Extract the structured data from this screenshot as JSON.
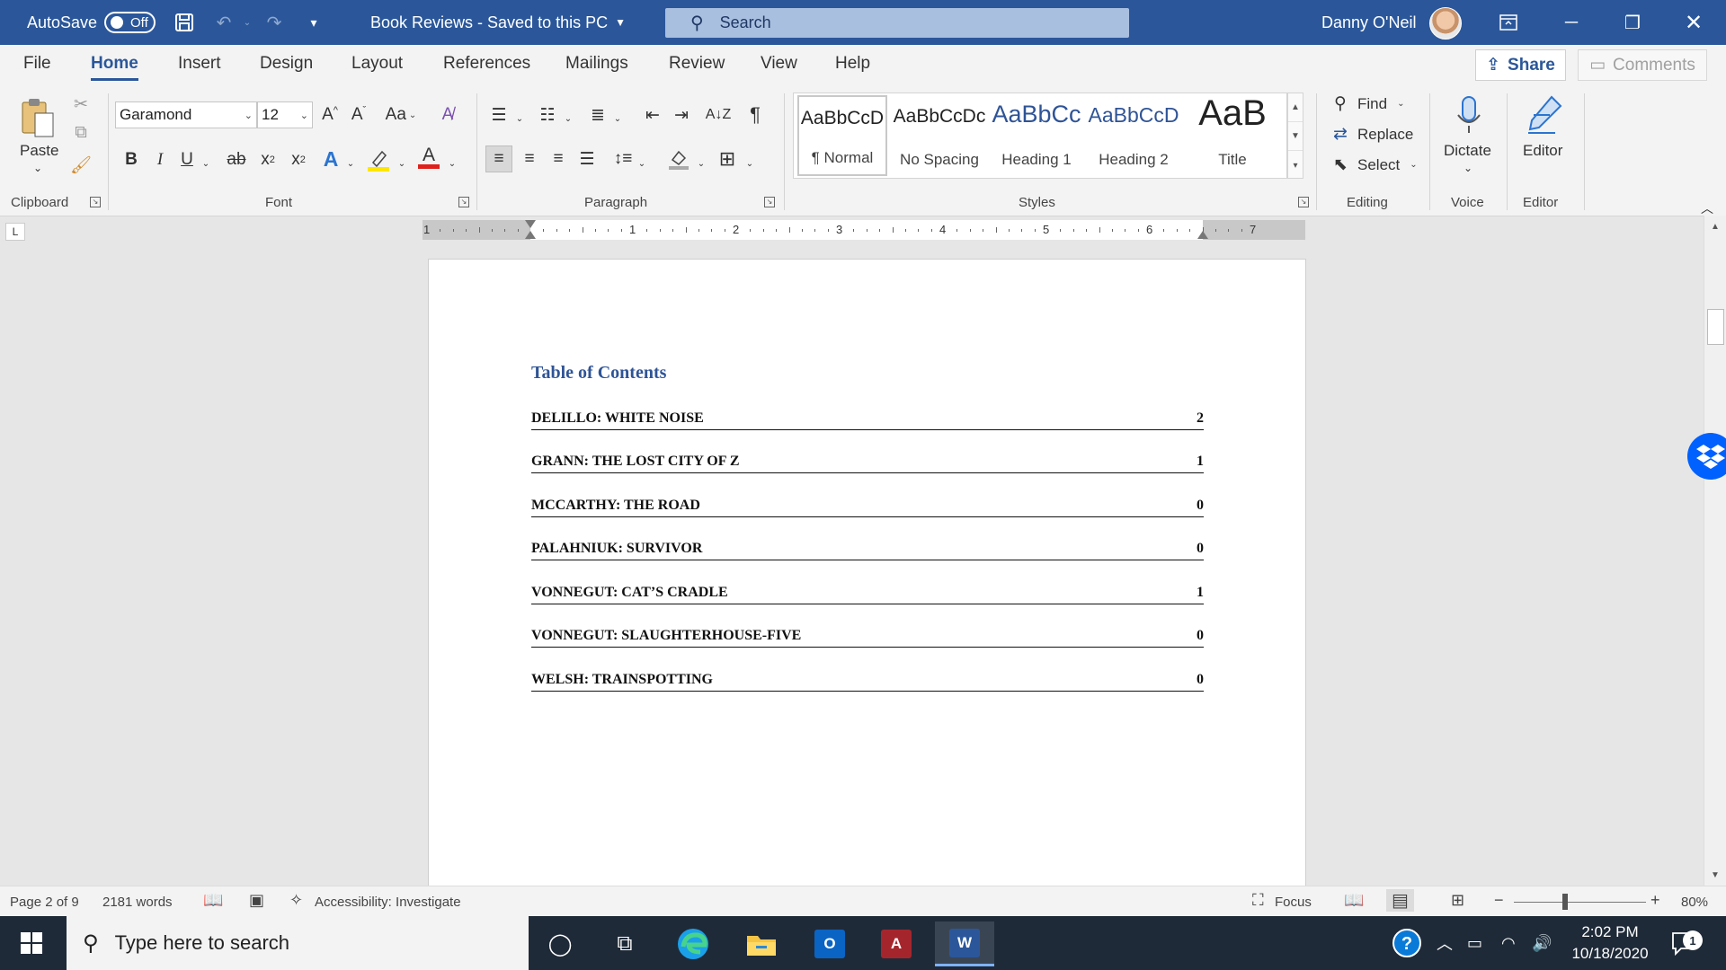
{
  "titlebar": {
    "autosave_label": "AutoSave",
    "autosave_state": "Off",
    "doc_title": "Book Reviews  -  Saved to this PC",
    "search_placeholder": "Search",
    "user_name": "Danny O'Neil"
  },
  "menu": {
    "tabs": [
      "File",
      "Home",
      "Insert",
      "Design",
      "Layout",
      "References",
      "Mailings",
      "Review",
      "View",
      "Help"
    ],
    "active_tab": "Home",
    "share_label": "Share",
    "comments_label": "Comments"
  },
  "ribbon": {
    "clipboard": {
      "paste_label": "Paste",
      "group_label": "Clipboard"
    },
    "font": {
      "font_name": "Garamond",
      "font_size": "12",
      "change_case_label": "Aa",
      "bold": "B",
      "italic": "I",
      "underline": "U",
      "strikethrough": "ab",
      "subscript_base": "x",
      "subscript_mark": "2",
      "superscript_base": "x",
      "superscript_mark": "2",
      "text_effects_label": "A",
      "font_color_label": "A",
      "group_label": "Font"
    },
    "paragraph": {
      "group_label": "Paragraph",
      "pilcrow": "¶"
    },
    "styles": {
      "tiles": [
        {
          "sample": "AaBbCcD",
          "name": "¶ Normal"
        },
        {
          "sample": "AaBbCcDc",
          "name": "No Spacing"
        },
        {
          "sample": "AaBbCc",
          "name": "Heading 1"
        },
        {
          "sample": "AaBbCcD",
          "name": "Heading 2"
        },
        {
          "sample": "AaB",
          "name": "Title"
        }
      ],
      "group_label": "Styles"
    },
    "editing": {
      "find_label": "Find",
      "replace_label": "Replace",
      "select_label": "Select",
      "group_label": "Editing"
    },
    "voice": {
      "dictate_label": "Dictate",
      "group_label": "Voice"
    },
    "editor": {
      "editor_label": "Editor",
      "group_label": "Editor"
    }
  },
  "ruler": {
    "numbers": [
      "1",
      "1",
      "2",
      "3",
      "4",
      "5",
      "6",
      "7"
    ]
  },
  "document": {
    "toc_title": "Table of Contents",
    "toc_entries": [
      {
        "text": "DELILLO: WHITE NOISE",
        "page": "2"
      },
      {
        "text": "GRANN: THE LOST CITY OF Z",
        "page": "1"
      },
      {
        "text": "MCCARTHY: THE ROAD",
        "page": "0"
      },
      {
        "text": "PALAHNIUK: SURVIVOR",
        "page": "0"
      },
      {
        "text": "VONNEGUT: CAT’S CRADLE",
        "page": "1"
      },
      {
        "text": "VONNEGUT: SLAUGHTERHOUSE-FIVE",
        "page": "0"
      },
      {
        "text": "WELSH: TRAINSPOTTING",
        "page": "0"
      }
    ]
  },
  "statusbar": {
    "page_info": "Page 2 of 9",
    "word_count": "2181 words",
    "accessibility": "Accessibility: Investigate",
    "focus_label": "Focus",
    "zoom_level": "80%",
    "zoom_minus": "−",
    "zoom_plus": "+"
  },
  "taskbar": {
    "search_placeholder": "Type here to search",
    "time": "2:02 PM",
    "date": "10/18/2020",
    "notification_count": "1",
    "outlook_letter": "O",
    "access_letter": "A",
    "word_letter": "W"
  },
  "colors": {
    "word_blue": "#2b579a",
    "heading_blue": "#2f5496",
    "taskbar": "#1f2a38",
    "dropbox": "#0061fe"
  }
}
